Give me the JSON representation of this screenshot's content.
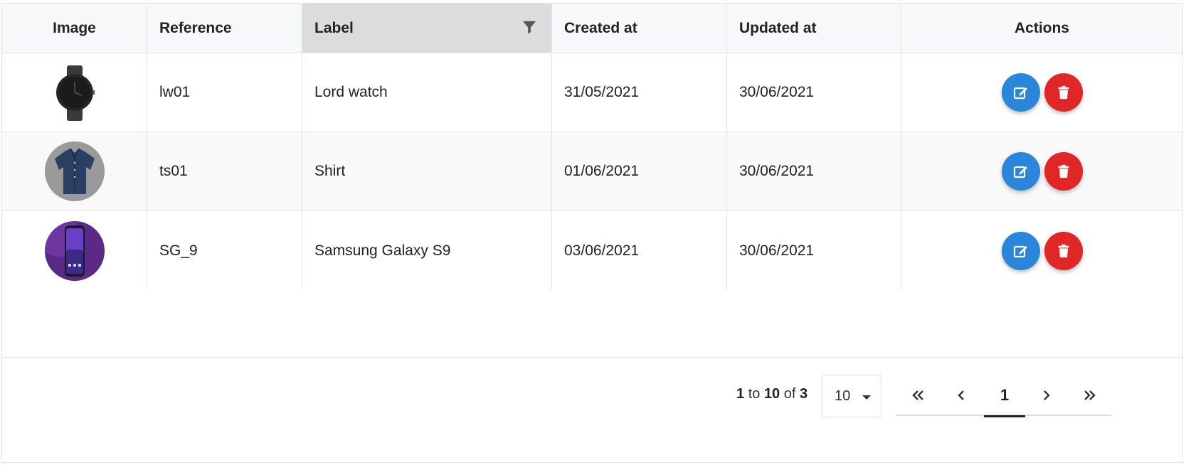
{
  "columns": {
    "image": "Image",
    "reference": "Reference",
    "label": "Label",
    "created_at": "Created at",
    "updated_at": "Updated at",
    "actions": "Actions"
  },
  "rows": [
    {
      "reference": "lw01",
      "label": "Lord watch",
      "created_at": "31/05/2021",
      "updated_at": "30/06/2021",
      "image": "watch"
    },
    {
      "reference": "ts01",
      "label": "Shirt",
      "created_at": "01/06/2021",
      "updated_at": "30/06/2021",
      "image": "shirt"
    },
    {
      "reference": "SG_9",
      "label": "Samsung Galaxy S9",
      "created_at": "03/06/2021",
      "updated_at": "30/06/2021",
      "image": "phone"
    }
  ],
  "icons": {
    "filter": "filter-icon",
    "edit": "edit-icon",
    "delete": "trash-icon",
    "first": "double-chevron-left-icon",
    "prev": "chevron-left-icon",
    "next": "chevron-right-icon",
    "last": "double-chevron-right-icon"
  },
  "colors": {
    "edit": "#2a86d8",
    "delete": "#e02626",
    "header_bg": "#f7f8f9",
    "active_header_bg": "#dcdcdc"
  },
  "pagination": {
    "from": "1",
    "to_word": "to",
    "to": "10",
    "of_word": "of",
    "total": "3",
    "page_size": "10",
    "current_page": "1"
  }
}
